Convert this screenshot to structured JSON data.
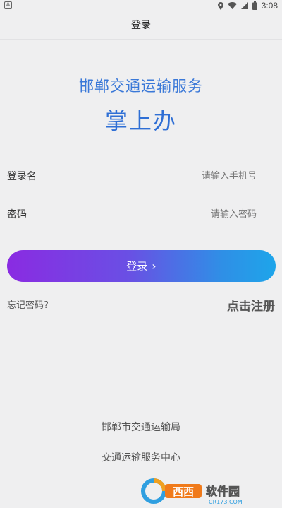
{
  "status_bar": {
    "time": "3:08",
    "icons": [
      "notification-a-icon",
      "location-icon",
      "wifi-icon",
      "cellular-signal-icon",
      "battery-icon"
    ]
  },
  "header": {
    "title": "登录"
  },
  "branding": {
    "org_name": "邯郸交通运输服务",
    "app_name": "掌上办"
  },
  "form": {
    "username_label": "登录名",
    "username_placeholder": "请输入手机号",
    "password_label": "密码",
    "password_placeholder": "请输入密码",
    "login_label": "登录",
    "login_chevron": "›",
    "forgot_label": "忘记密码?",
    "register_label": "点击注册"
  },
  "footer": {
    "line1": "邯郸市交通运输局",
    "line2": "交通运输服务中心"
  },
  "watermark": {
    "brand": "西西软件园",
    "domain": "CR173.COM"
  },
  "colors": {
    "background": "#efeff0",
    "title_blue": "#3a78d8",
    "gradient_start": "#8a2be2",
    "gradient_end": "#1ea5ea"
  }
}
